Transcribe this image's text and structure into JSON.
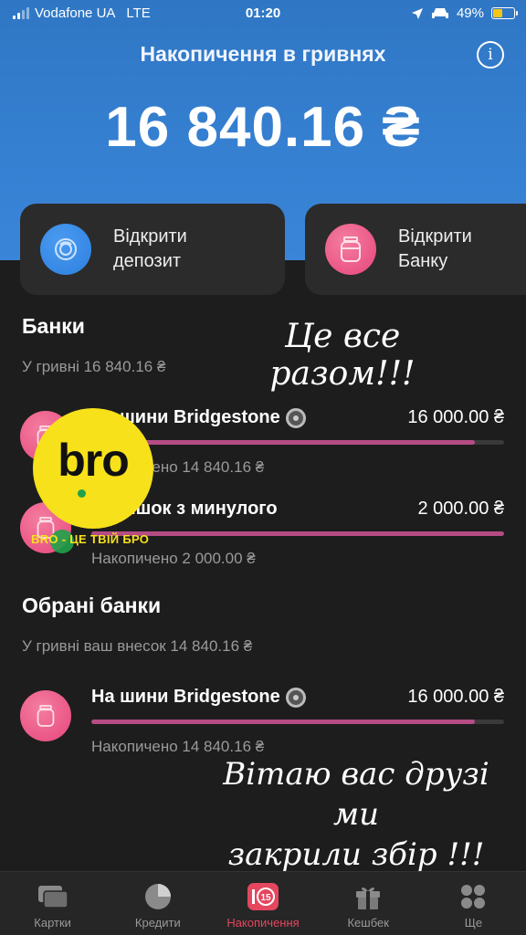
{
  "status_bar": {
    "carrier": "Vodafone UA",
    "network": "LTE",
    "time": "01:20",
    "battery": "49%",
    "battery_level": 0.49
  },
  "header": {
    "title": "Накопичення в гривнях",
    "balance": "16 840.16 ₴",
    "info_icon": "info-icon"
  },
  "actions": [
    {
      "label_line1": "Відкрити",
      "label_line2": "депозит",
      "icon": "deposit-icon",
      "color": "#2d7fe0"
    },
    {
      "label_line1": "Відкрити",
      "label_line2": "Банку",
      "icon": "jar-icon",
      "color": "#e6457a"
    }
  ],
  "banks_section": {
    "title": "Банки",
    "subtitle": "У гривні 16 840.16 ₴",
    "items": [
      {
        "name": "На шини Bridgestone",
        "goal": "16 000.00 ₴",
        "saved": "Накопичено 14 840.16 ₴",
        "progress": 0.93,
        "badge_icon": "tire-icon"
      },
      {
        "name": "Залишок з минулого",
        "goal": "2 000.00 ₴",
        "saved": "Накопичено 2 000.00 ₴",
        "progress": 1.0
      }
    ]
  },
  "favorites_section": {
    "title": "Обрані банки",
    "subtitle": "У гривні ваш внесок 14 840.16 ₴",
    "items": [
      {
        "name": "На шини Bridgestone",
        "goal": "16 000.00 ₴",
        "saved": "Накопичено 14 840.16 ₴",
        "progress": 0.93,
        "badge_icon": "tire-icon"
      }
    ]
  },
  "overlays": {
    "note_top": "Це все разом!!!",
    "note_bottom_line1": "Вітаю вас друзі ми",
    "note_bottom_line2": "закрили збір !!!",
    "sticker_text": "bro",
    "sticker_caption": "BRO - ЦЕ ТВІЙ БРО",
    "sticker_color": "#f7e11b"
  },
  "tabbar": {
    "tabs": [
      {
        "label": "Картки",
        "icon": "cards-icon",
        "active": false
      },
      {
        "label": "Кредити",
        "icon": "pie-chart-icon",
        "active": false
      },
      {
        "label": "Накопичення",
        "icon": "savings-icon",
        "badge": "15",
        "active": true
      },
      {
        "label": "Кешбек",
        "icon": "gift-icon",
        "active": false
      },
      {
        "label": "Ще",
        "icon": "more-icon",
        "active": false
      }
    ]
  }
}
